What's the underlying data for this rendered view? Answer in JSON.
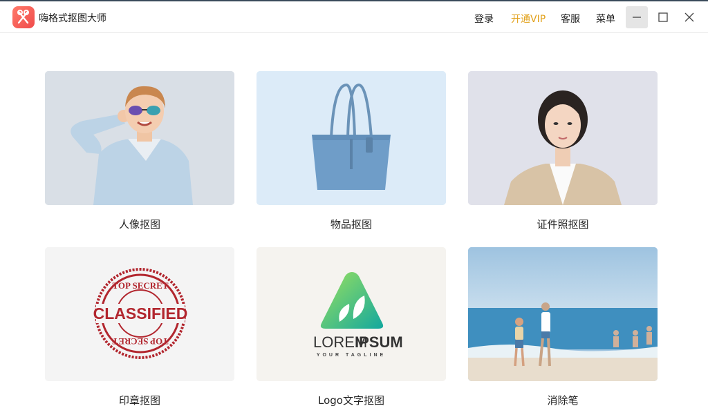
{
  "app": {
    "title": "嗨格式抠图大师"
  },
  "header": {
    "login": "登录",
    "vip": "开通VIP",
    "service": "客服",
    "menu": "菜单"
  },
  "colors": {
    "vip": "#e2a11a",
    "brand": "#f04b4b"
  },
  "cards": [
    {
      "label": "人像抠图"
    },
    {
      "label": "物品抠图"
    },
    {
      "label": "证件照抠图"
    },
    {
      "label": "印章抠图",
      "stamp": {
        "top": "TOP SECRET",
        "main": "CLASSIFIED",
        "bottom": "TOP SECRET"
      }
    },
    {
      "label": "Logo文字抠图",
      "logo": {
        "main_a": "LOREM",
        "main_b": "IPSUM",
        "tagline": "YOUR TAGLINE"
      }
    },
    {
      "label": "消除笔"
    }
  ]
}
